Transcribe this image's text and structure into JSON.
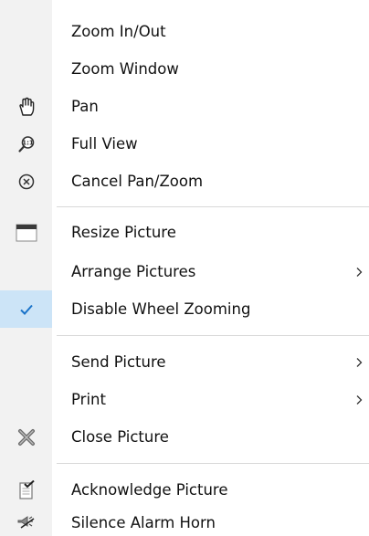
{
  "menu": {
    "items": [
      {
        "label": "Zoom In/Out",
        "icon": ""
      },
      {
        "label": "Zoom Window",
        "icon": ""
      },
      {
        "label": "Pan",
        "icon": "hand-icon"
      },
      {
        "label": "Full View",
        "icon": "zoom-fit-icon"
      },
      {
        "label": "Cancel Pan/Zoom",
        "icon": "cancel-circle-icon"
      },
      {
        "label": "Resize Picture",
        "icon": "window-icon"
      },
      {
        "label": "Arrange Pictures",
        "icon": "",
        "submenu": true
      },
      {
        "label": "Disable Wheel Zooming",
        "icon": "check-icon",
        "checked": true
      },
      {
        "label": "Send Picture",
        "icon": "",
        "submenu": true
      },
      {
        "label": "Print",
        "icon": "",
        "submenu": true
      },
      {
        "label": "Close Picture",
        "icon": "close-x-icon"
      },
      {
        "label": "Acknowledge Picture",
        "icon": "acknowledge-icon"
      },
      {
        "label": "Silence Alarm Horn",
        "icon": "horn-icon"
      }
    ]
  },
  "colors": {
    "gutter": "#f2f2f2",
    "check_highlight": "#cce4f7",
    "check_mark": "#1a73c9",
    "separator": "#d8d8d8"
  }
}
